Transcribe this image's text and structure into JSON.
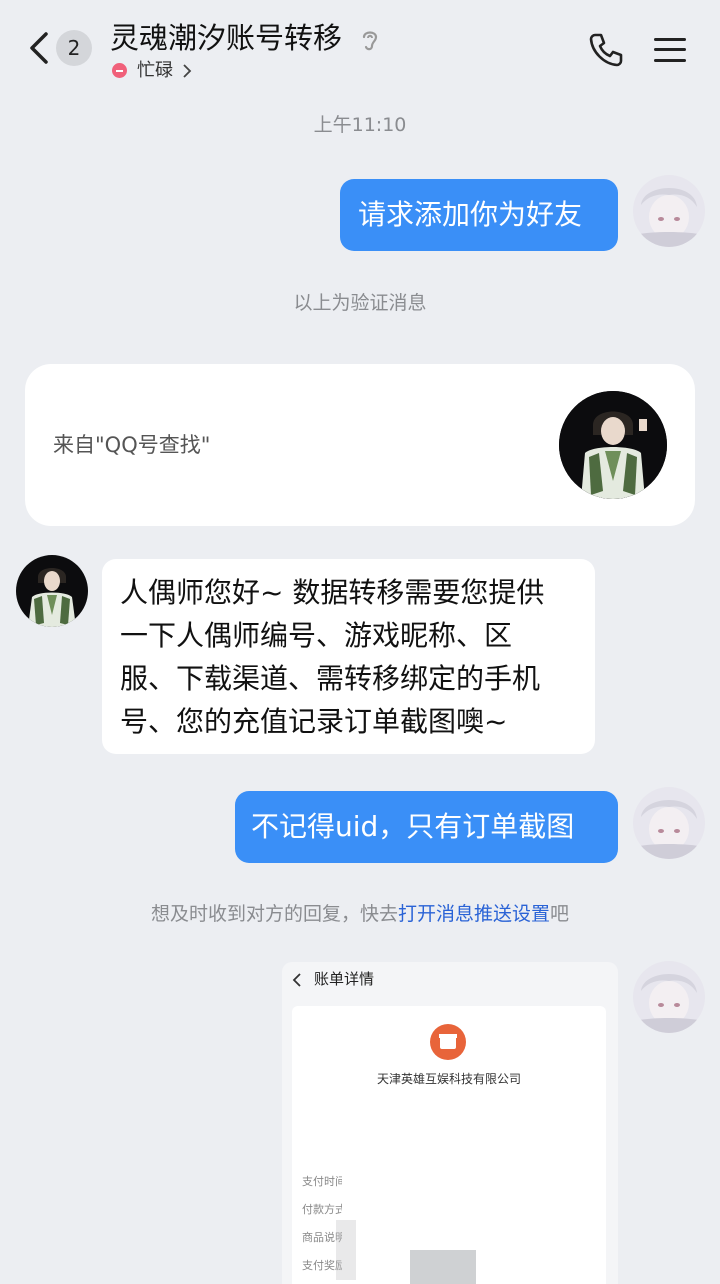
{
  "header": {
    "unread_count": "2",
    "title": "灵魂潮汐账号转移",
    "status": "忙碌"
  },
  "messages": {
    "time": "上午11:10",
    "friend_request": "请求添加你为好友",
    "verify_note": "以上为验证消息",
    "source_card": "来自\"QQ号查找\"",
    "agent_reply_lines": [
      "人偶师您好~ 数据转移需要您提供",
      "一下人偶师编号、游戏昵称、区",
      "服、下载渠道、需转移绑定的手机",
      "号、您的充值记录订单截图噢~"
    ],
    "user_reply": "不记得uid，只有订单截图",
    "push_hint_prefix": "想及时收到对方的回复，快去",
    "push_hint_link": "打开消息推送设置",
    "push_hint_suffix": "吧"
  },
  "screenshot": {
    "title": "账单详情",
    "company": "天津英雄互娱科技有限公司",
    "rows": [
      "支付时间",
      "付款方式",
      "商品说明",
      "支付奖励"
    ]
  },
  "colors": {
    "bubble_blue": "#3a8ff7",
    "background": "#eceef2",
    "link": "#2a63d6",
    "busy": "#f0607a",
    "logo": "#e8643a"
  },
  "icons": [
    "back-chevron-icon",
    "ear-icon",
    "busy-status-icon",
    "chevron-right-icon",
    "phone-icon",
    "menu-icon"
  ]
}
